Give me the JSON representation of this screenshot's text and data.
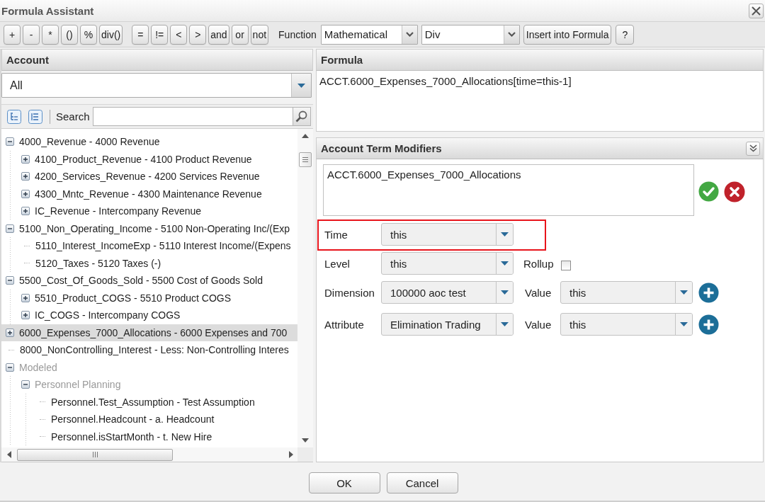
{
  "window": {
    "title": "Formula Assistant"
  },
  "toolbar": {
    "operator_groups": [
      [
        "+",
        "-",
        "*",
        "()",
        "%",
        "div()"
      ],
      [
        "=",
        "!=",
        "<",
        ">",
        "and",
        "or",
        "not"
      ]
    ],
    "function_label": "Function",
    "function_category": "Mathematical",
    "function_name": "Div",
    "insert_button": "Insert into Formula",
    "help_button": "?"
  },
  "account_panel": {
    "title": "Account",
    "filter": "All",
    "search_label": "Search",
    "tree": [
      {
        "label": "4000_Revenue - 4000 Revenue",
        "kind": "branch",
        "expanded": true,
        "selected": false,
        "disabled": false,
        "children": [
          {
            "label": "4100_Product_Revenue - 4100 Product Revenue",
            "kind": "branch",
            "expanded": false,
            "selected": false,
            "disabled": false
          },
          {
            "label": "4200_Services_Revenue - 4200 Services Revenue",
            "kind": "branch",
            "expanded": false,
            "selected": false,
            "disabled": false
          },
          {
            "label": "4300_Mntc_Revenue - 4300 Maintenance Revenue",
            "kind": "branch",
            "expanded": false,
            "selected": false,
            "disabled": false
          },
          {
            "label": "IC_Revenue - Intercompany Revenue",
            "kind": "branch",
            "expanded": false,
            "selected": false,
            "disabled": false
          }
        ]
      },
      {
        "label": "5100_Non_Operating_Income - 5100 Non-Operating Inc/(Exp",
        "kind": "branch",
        "expanded": true,
        "selected": false,
        "disabled": false,
        "children": [
          {
            "label": "5110_Interest_IncomeExp - 5110 Interest Income/(Expens",
            "kind": "leaf",
            "selected": false,
            "disabled": false
          },
          {
            "label": "5120_Taxes - 5120 Taxes (-)",
            "kind": "leaf",
            "selected": false,
            "disabled": false
          }
        ]
      },
      {
        "label": "5500_Cost_Of_Goods_Sold - 5500 Cost of Goods Sold",
        "kind": "branch",
        "expanded": true,
        "selected": false,
        "disabled": false,
        "children": [
          {
            "label": "5510_Product_COGS - 5510 Product COGS",
            "kind": "branch",
            "expanded": false,
            "selected": false,
            "disabled": false
          },
          {
            "label": "IC_COGS - Intercompany COGS",
            "kind": "branch",
            "expanded": false,
            "selected": false,
            "disabled": false
          }
        ]
      },
      {
        "label": "6000_Expenses_7000_Allocations - 6000 Expenses and 700",
        "kind": "branch",
        "expanded": false,
        "selected": true,
        "disabled": false
      },
      {
        "label": "8000_NonControlling_Interest - Less: Non-Controlling Interes",
        "kind": "leaf",
        "selected": false,
        "disabled": false
      },
      {
        "label": "Modeled",
        "kind": "branch",
        "expanded": true,
        "selected": false,
        "disabled": true,
        "children": [
          {
            "label": "Personnel Planning",
            "kind": "branch",
            "expanded": true,
            "selected": false,
            "disabled": true,
            "children": [
              {
                "label": "Personnel.Test_Assumption - Test Assumption",
                "kind": "leaf",
                "selected": false,
                "disabled": false
              },
              {
                "label": "Personnel.Headcount - a. Headcount",
                "kind": "leaf",
                "selected": false,
                "disabled": false
              },
              {
                "label": "Personnel.isStartMonth - t. New Hire",
                "kind": "leaf",
                "selected": false,
                "disabled": false
              }
            ]
          }
        ]
      }
    ]
  },
  "formula_panel": {
    "title": "Formula",
    "value": "ACCT.6000_Expenses_7000_Allocations[time=this-1]"
  },
  "modifiers_panel": {
    "title": "Account Term Modifiers",
    "term": "ACCT.6000_Expenses_7000_Allocations",
    "rows": [
      {
        "kind": "plain",
        "label": "Time",
        "value": "this",
        "highlighted": true
      },
      {
        "kind": "rollup",
        "label": "Level",
        "value": "this",
        "highlighted": false,
        "option_label": "Rollup",
        "checked": false
      },
      {
        "kind": "value",
        "label": "Dimension",
        "value": "100000 aoc test",
        "highlighted": false,
        "value_label": "Value",
        "second_value": "this"
      },
      {
        "kind": "value",
        "label": "Attribute",
        "value": "Elimination Trading",
        "highlighted": false,
        "value_label": "Value",
        "second_value": "this"
      }
    ]
  },
  "buttons": [
    "OK",
    "Cancel"
  ]
}
